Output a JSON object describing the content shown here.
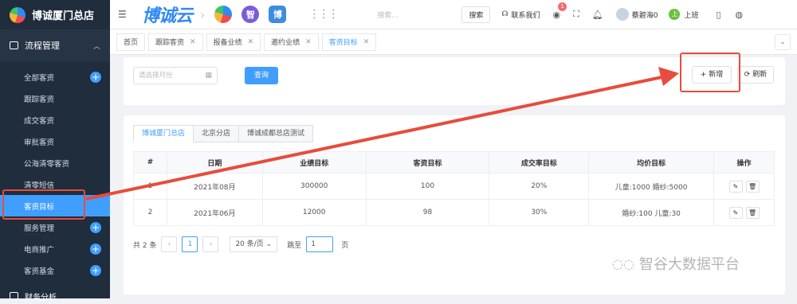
{
  "brand": {
    "title": "博诚厦门总店"
  },
  "sidebar": {
    "group": "流程管理",
    "items": [
      {
        "label": "全部客资",
        "plus": true
      },
      {
        "label": "跟踪客资",
        "plus": false
      },
      {
        "label": "成交客资",
        "plus": false
      },
      {
        "label": "审批客资",
        "plus": false
      },
      {
        "label": "公海清零客资",
        "plus": false
      },
      {
        "label": "清零短信",
        "plus": false
      },
      {
        "label": "客资目标",
        "plus": false,
        "active": true
      },
      {
        "label": "服务管理",
        "plus": true
      },
      {
        "label": "电商推广",
        "plus": true
      },
      {
        "label": "客资基金",
        "plus": true
      }
    ],
    "group2": "财务分析"
  },
  "topbar": {
    "logo": "博诚云",
    "app_icon_2": "智",
    "app_icon_3": "博",
    "search_placeholder": "搜索...",
    "search_button": "搜索",
    "contact": "联系我们",
    "badge_count": "1",
    "user_name": "蔡碧海0",
    "clock_in": "上班",
    "clock_in_icon": "上"
  },
  "tabs": [
    {
      "label": "首页",
      "closable": false
    },
    {
      "label": "跟踪客资",
      "closable": true
    },
    {
      "label": "报备业绩",
      "closable": true
    },
    {
      "label": "邀约业绩",
      "closable": true
    },
    {
      "label": "客资目标",
      "closable": true,
      "active": true
    }
  ],
  "filter": {
    "date_placeholder": "请选择月份",
    "query_button": "查询",
    "add_button": "+ 新增",
    "refresh_button": "⟳ 刷新"
  },
  "store_tabs": [
    "博诚厦门总店",
    "北京分店",
    "博诚成都总店测试"
  ],
  "table": {
    "headers": [
      "#",
      "日期",
      "业绩目标",
      "客资目标",
      "成交率目标",
      "均价目标",
      "操作"
    ],
    "rows": [
      [
        "1",
        "2021年08月",
        "300000",
        "100",
        "20%",
        "儿童:1000 婚纱:5000"
      ],
      [
        "2",
        "2021年06月",
        "12000",
        "98",
        "30%",
        "婚纱:100 儿童:30"
      ]
    ]
  },
  "pager": {
    "total": "共 2 条",
    "page": "1",
    "page_size": "20 条/页 ⌄",
    "goto_label": "跳至",
    "goto_value": "1",
    "page_unit": "页"
  },
  "watermark": "智谷大数据平台",
  "colors": {
    "sidebar_bg": "#1f2d3d",
    "accent": "#409eff",
    "annotation": "#e74c3c"
  }
}
